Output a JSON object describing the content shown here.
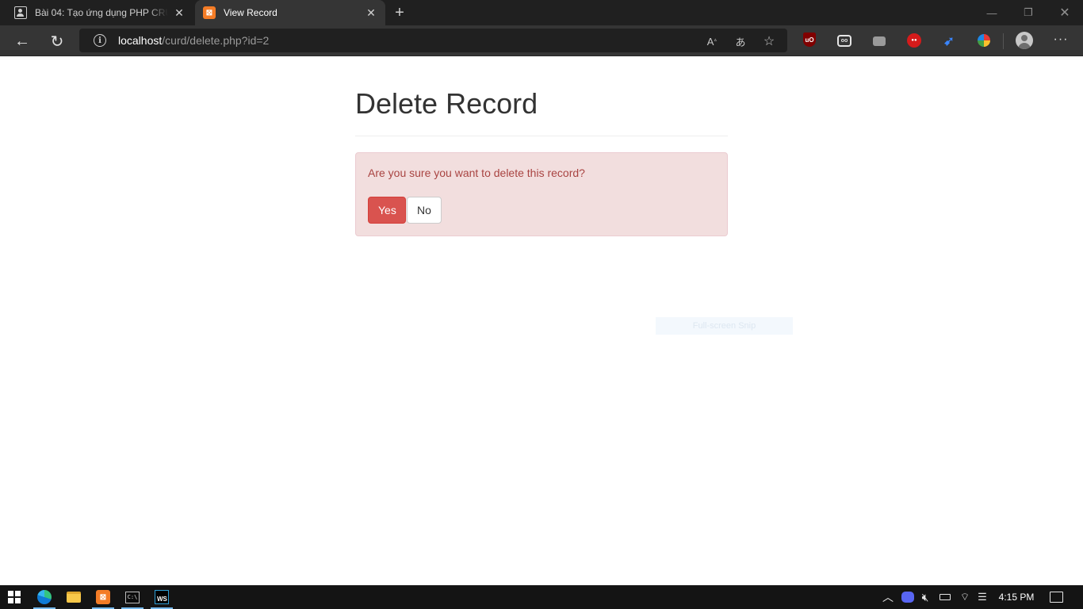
{
  "browser": {
    "tabs": [
      {
        "title": "Bài 04: Tạo ứng dụng PHP CRUD",
        "icon": "profile-page-icon",
        "active": false
      },
      {
        "title": "View Record",
        "icon": "xampp-icon",
        "active": true
      }
    ],
    "address": {
      "host": "localhost",
      "path": "/curd/delete.php?id=2"
    }
  },
  "page": {
    "title": "Delete Record",
    "alert": {
      "message": "Are you sure you want to delete this record?",
      "yes_label": "Yes",
      "no_label": "No"
    },
    "snip_overlay": "Full-screen Snip"
  },
  "taskbar": {
    "time": "4:15 PM",
    "apps": [
      "start",
      "edge",
      "file-explorer",
      "xampp",
      "command-prompt",
      "webstorm"
    ]
  },
  "colors": {
    "danger": "#d9534f",
    "alert_bg": "#f2dede",
    "alert_text": "#a94442",
    "browser_chrome": "#353535"
  }
}
